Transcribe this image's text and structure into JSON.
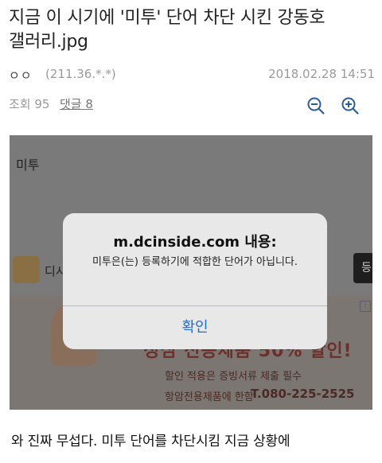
{
  "post": {
    "title_line1": "지금 이 시기에 '미투' 단어 차단 시킨 강동호",
    "title_line2": "갤러리.jpg",
    "author": "ㅇㅇ",
    "ip": "(211.36.*.*)",
    "date": "2018.02.28 14:51",
    "views_label": "조회 95",
    "comments_label": "댓글 8",
    "body_text": "와 진짜 무섭다. 미투 단어를 차단시킴 지금 상황에"
  },
  "toolbar": {
    "zoom_out_icon": "zoom-out-icon",
    "zoom_in_icon": "zoom-in-icon",
    "accent": "#2a5d9a"
  },
  "screenshot": {
    "word": "미투",
    "row_label": "디시",
    "button_label": "등",
    "ad": {
      "headline": "정심 전용제품 50% 할인!",
      "line1": "할인 적용은 증빙서류 제출 필수",
      "line2": "항암전용제품에 한함",
      "phone": "T.080-225-2525",
      "badge": "i"
    }
  },
  "dialog": {
    "title": "m.dcinside.com 내용:",
    "message": "미투은(는) 등록하기에 적합한 단어가 아닙니다.",
    "confirm_label": "확인",
    "button_color": "#1a6ddb"
  }
}
